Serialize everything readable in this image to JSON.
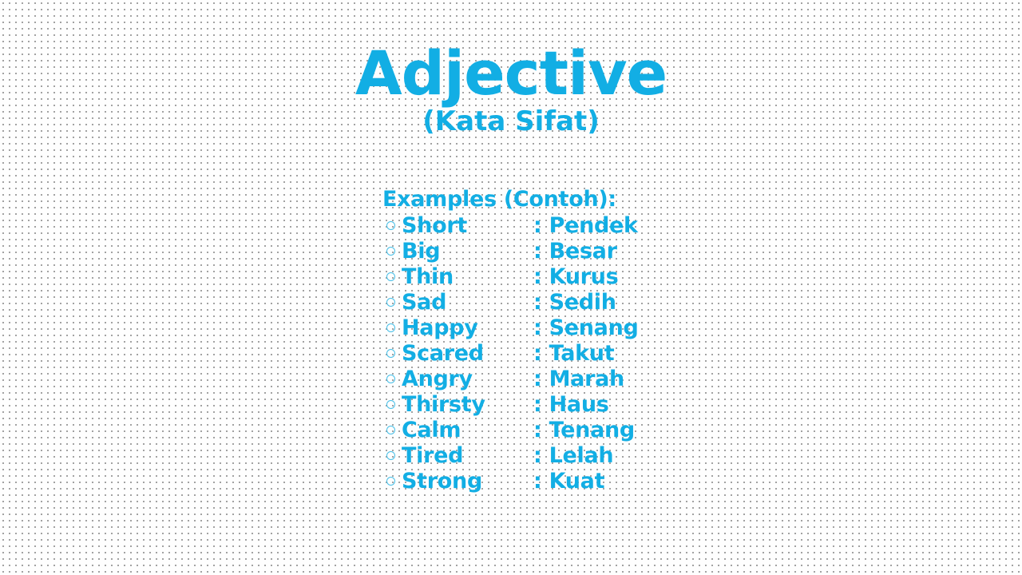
{
  "slide": {
    "title": "Adjective",
    "subtitle": "(Kata Sifat)",
    "accent_color": "#12AEE4",
    "background_color": "#FEFEFE",
    "background_dot_color": "#9A9A9A"
  },
  "body": {
    "examples_heading": "Examples (Contoh):",
    "bullet_glyph_name": "hollow-circle-bullet-icon",
    "separator": ":",
    "items": [
      {
        "english": "Short",
        "separator": ":",
        "indonesian": "Pendek"
      },
      {
        "english": "Big",
        "separator": ":",
        "indonesian": "Besar"
      },
      {
        "english": "Thin",
        "separator": ":",
        "indonesian": "Kurus"
      },
      {
        "english": "Sad",
        "separator": ":",
        "indonesian": "Sedih"
      },
      {
        "english": "Happy",
        "separator": ":",
        "indonesian": "Senang"
      },
      {
        "english": "Scared",
        "separator": ":",
        "indonesian": "Takut"
      },
      {
        "english": "Angry",
        "separator": ":",
        "indonesian": "Marah"
      },
      {
        "english": "Thirsty",
        "separator": ":",
        "indonesian": "Haus"
      },
      {
        "english": "Calm",
        "separator": ":",
        "indonesian": "Tenang"
      },
      {
        "english": "Tired",
        "separator": ":",
        "indonesian": "Lelah"
      },
      {
        "english": "Strong",
        "separator": ":",
        "indonesian": "Kuat"
      }
    ]
  }
}
